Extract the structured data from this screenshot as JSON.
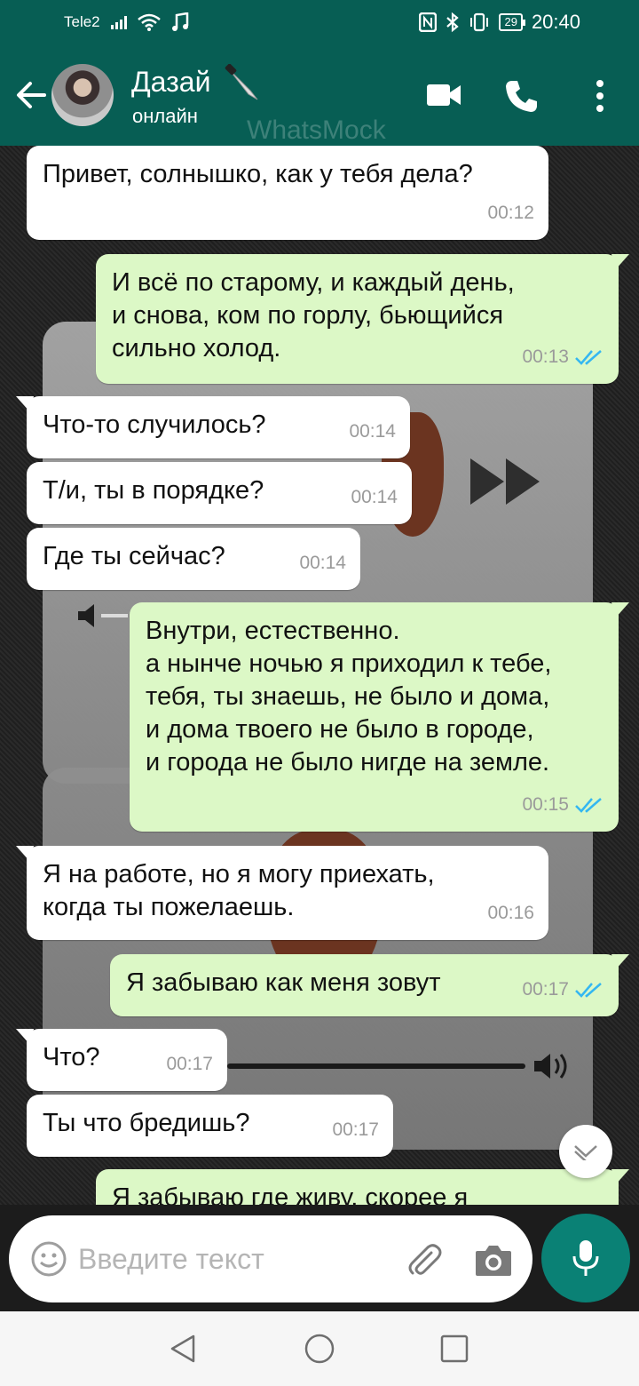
{
  "status_bar": {
    "carrier": "Tele2",
    "battery": "29",
    "time": "20:40",
    "icons": [
      "signal-icon",
      "wifi-icon",
      "music-icon",
      "nfc-icon",
      "bluetooth-icon",
      "vibrate-icon",
      "battery-icon"
    ]
  },
  "header": {
    "contact_name": "Дазай",
    "contact_emoji": "knife-icon",
    "status": "онлайн",
    "watermark": "WhatsMock",
    "icons": [
      "back-arrow-icon",
      "video-call-icon",
      "phone-icon",
      "more-vert-icon"
    ]
  },
  "colors": {
    "header": "#075e54",
    "incoming": "#ffffff",
    "outgoing": "#dcf8c6",
    "tick_read": "#34b7f1",
    "fab": "#0a8175"
  },
  "messages": [
    {
      "dir": "in",
      "text": "Привет, солнышко, как у тебя дела?",
      "time": "00:12"
    },
    {
      "dir": "out",
      "text": "И всё по старому, и каждый день,\nи снова, ком по горлу, бьющийся\nсильно холод.",
      "time": "00:13",
      "status": "read"
    },
    {
      "dir": "in",
      "text": "Что-то случилось?",
      "time": "00:14"
    },
    {
      "dir": "in",
      "text": "Т/и, ты в порядке?",
      "time": "00:14"
    },
    {
      "dir": "in",
      "text": "Где ты сейчас?",
      "time": "00:14"
    },
    {
      "dir": "out",
      "text": "Внутри, естественно.\nа нынче ночью я приходил к тебе,\nтебя, ты знаешь, не было и дома,\nи дома твоего не было в городе,\nи города не было нигде на земле.",
      "time": "00:15",
      "status": "read"
    },
    {
      "dir": "in",
      "text": "Я на работе, но я могу приехать,\nкогда ты пожелаешь.",
      "time": "00:16"
    },
    {
      "dir": "out",
      "text": "Я забываю как меня зовут",
      "time": "00:17",
      "status": "read"
    },
    {
      "dir": "in",
      "text": "Что?",
      "time": "00:17"
    },
    {
      "dir": "in",
      "text": "Ты что бредишь?",
      "time": "00:17"
    },
    {
      "dir": "out",
      "text": "Я забываю где живу, скорее я",
      "time": "",
      "status": ""
    }
  ],
  "input": {
    "placeholder": "Введите текст",
    "icons": [
      "emoji-icon",
      "paperclip-icon",
      "camera-icon",
      "mic-icon"
    ]
  },
  "nav": {
    "icons": [
      "nav-back-icon",
      "nav-home-icon",
      "nav-recent-icon"
    ]
  }
}
